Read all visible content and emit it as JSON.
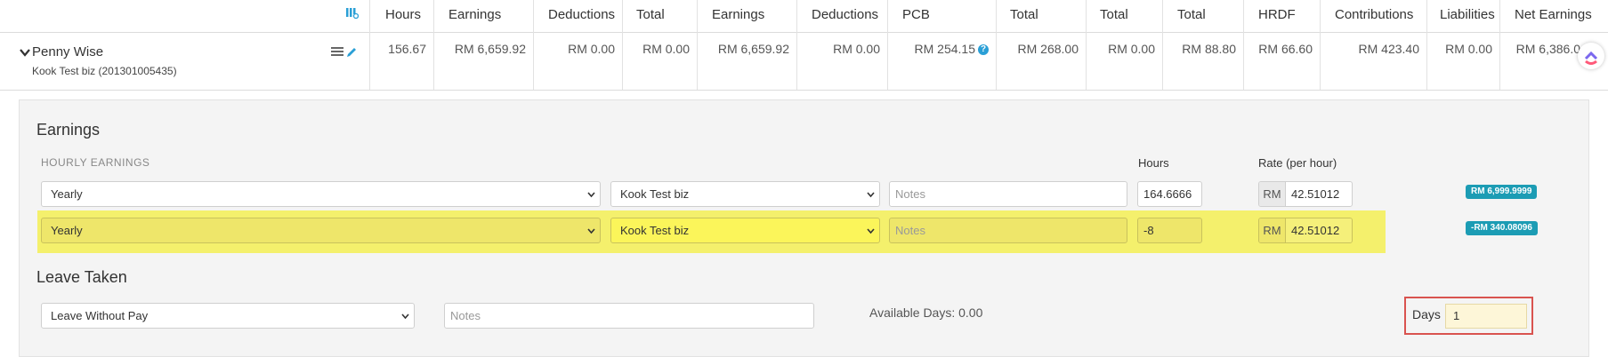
{
  "columns": {
    "hours": "Hours",
    "earnings": "Earnings",
    "deductions": "Deductions",
    "total_1": "Total",
    "earnings_2": "Earnings",
    "deductions_2": "Deductions",
    "pcb": "PCB",
    "total_2": "Total",
    "total_3": "Total",
    "total_4": "Total",
    "hrdf": "HRDF",
    "contributions": "Contributions",
    "liabilities": "Liabilities",
    "net_earnings": "Net Earnings"
  },
  "employee": {
    "name": "Penny Wise",
    "company": "Kook Test biz (201301005435)",
    "hours": "156.67",
    "earnings": "RM 6,659.92",
    "deductions": "RM 0.00",
    "total_1": "RM 0.00",
    "earnings_2": "RM 6,659.92",
    "deductions_2": "RM 0.00",
    "pcb": "RM 254.15",
    "total_2": "RM 268.00",
    "total_3": "RM 0.00",
    "total_4": "RM 88.80",
    "hrdf": "RM 66.60",
    "contributions": "RM 423.40",
    "liabilities": "RM 0.00",
    "net_earnings": "RM 6,386.0"
  },
  "earnings_section": {
    "title": "Earnings",
    "subtitle": "HOURLY EARNINGS",
    "hours_label": "Hours",
    "rate_label": "Rate (per hour)",
    "rows": [
      {
        "type": "Yearly",
        "company": "Kook Test biz",
        "notes_placeholder": "Notes",
        "hours": "164.6666",
        "currency": "RM",
        "rate": "42.51012",
        "amount": "RM 6,999.9999"
      },
      {
        "type": "Yearly",
        "company": "Kook Test biz",
        "notes_placeholder": "Notes",
        "hours": "-8",
        "currency": "RM",
        "rate": "42.51012",
        "amount": "-RM 340.08096"
      }
    ],
    "highlight_color": "#f4f06c"
  },
  "leave_section": {
    "title": "Leave Taken",
    "type": "Leave Without Pay",
    "notes_placeholder": "Notes",
    "available": "Available Days: 0.00",
    "days_label": "Days",
    "days_value": "1"
  },
  "icons": {
    "columns": "columns-icon",
    "collapse": "chevron-down-icon",
    "list": "list-icon",
    "edit": "pencil-icon",
    "help": "help-icon",
    "logo": "app-logo"
  },
  "colors": {
    "accent": "#2a9fd6",
    "badge": "#1c9cb4",
    "highlight_box": "#d9534f"
  }
}
